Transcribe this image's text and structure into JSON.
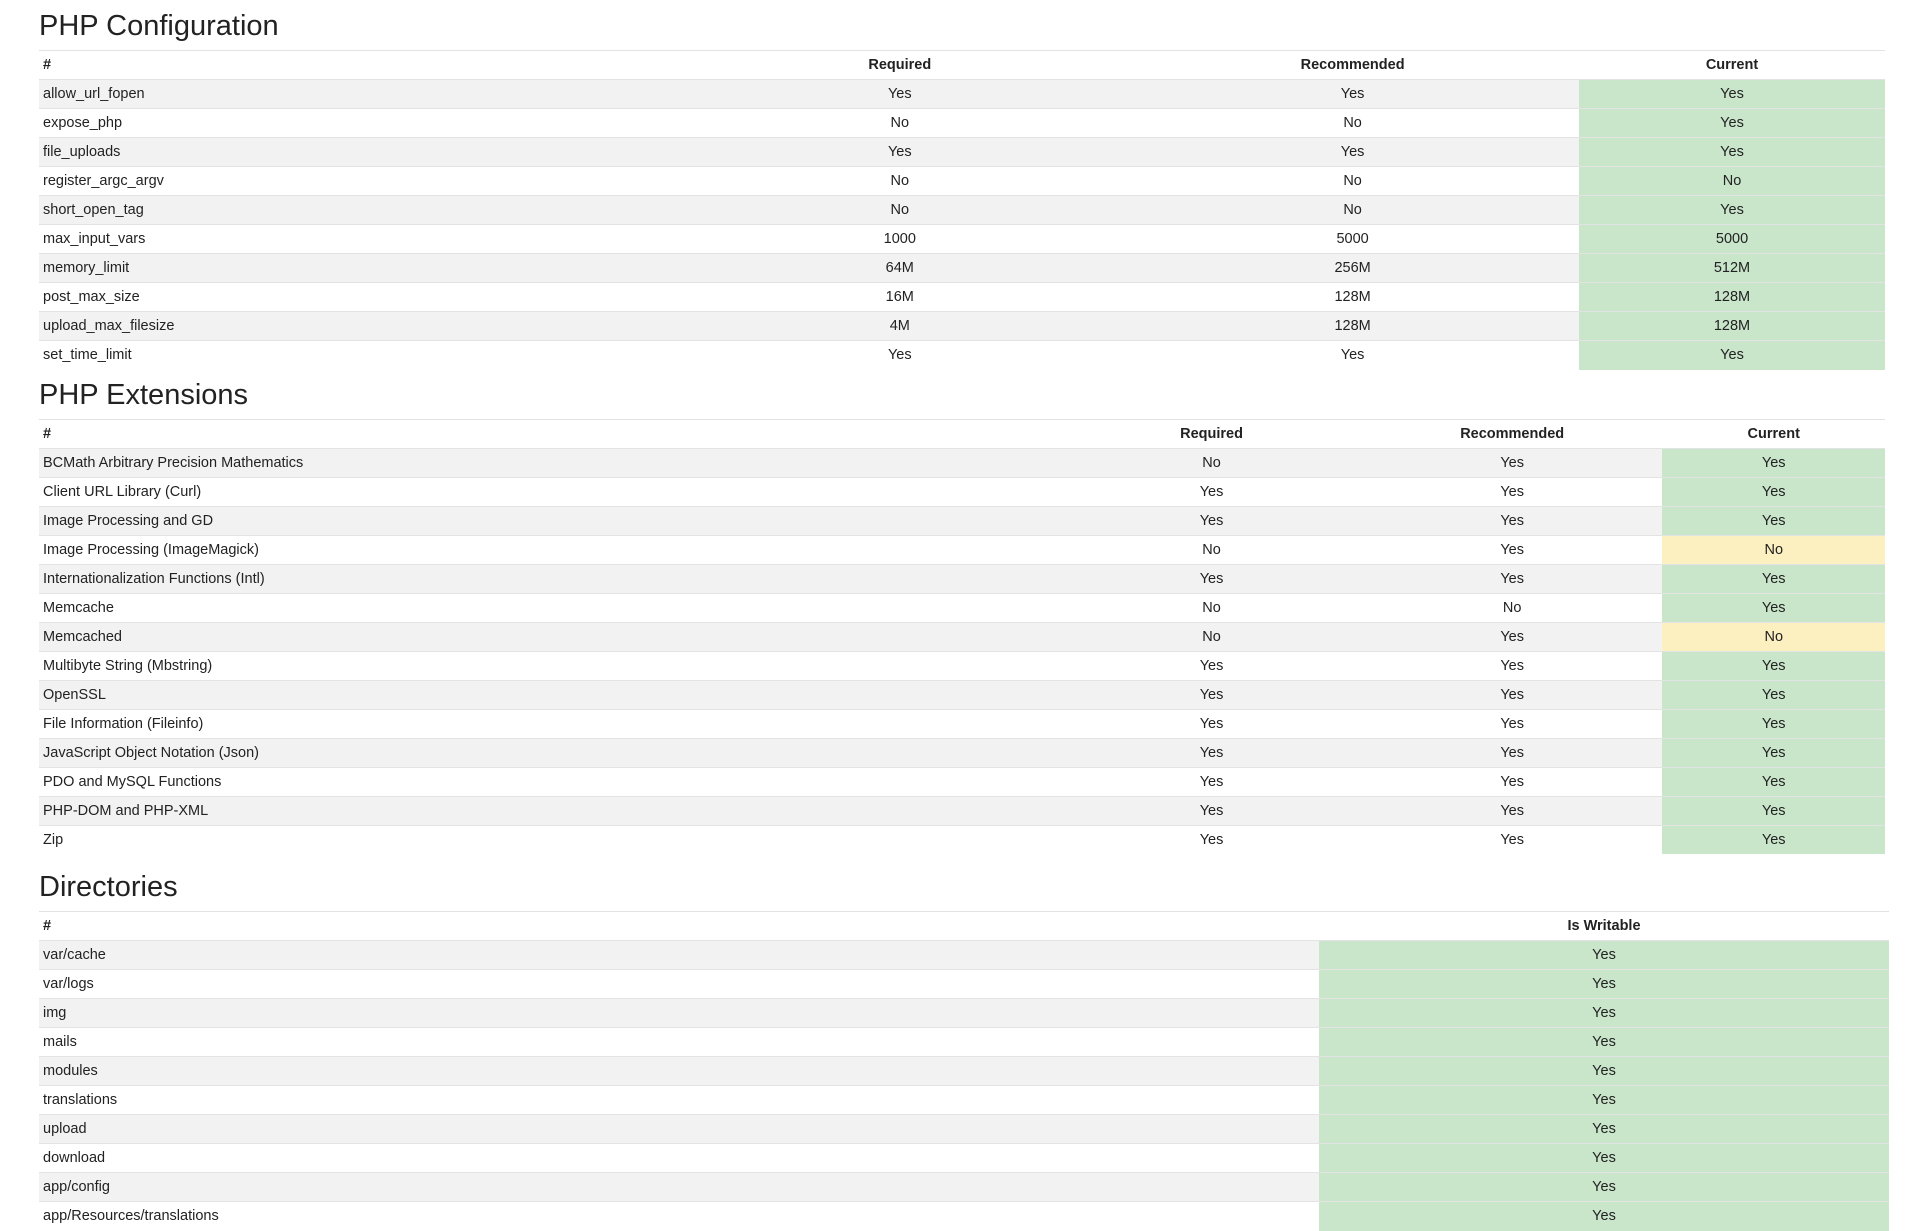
{
  "colors": {
    "ok": "#c9e6cb",
    "warn": "#fcefc0",
    "stripe": "#f2f2f2"
  },
  "config": {
    "title": "PHP Configuration",
    "headers": [
      "#",
      "Required",
      "Recommended",
      "Current"
    ],
    "rows": [
      {
        "name": "allow_url_fopen",
        "required": "Yes",
        "recommended": "Yes",
        "current": "Yes",
        "status": "ok"
      },
      {
        "name": "expose_php",
        "required": "No",
        "recommended": "No",
        "current": "Yes",
        "status": "ok"
      },
      {
        "name": "file_uploads",
        "required": "Yes",
        "recommended": "Yes",
        "current": "Yes",
        "status": "ok"
      },
      {
        "name": "register_argc_argv",
        "required": "No",
        "recommended": "No",
        "current": "No",
        "status": "ok"
      },
      {
        "name": "short_open_tag",
        "required": "No",
        "recommended": "No",
        "current": "Yes",
        "status": "ok"
      },
      {
        "name": "max_input_vars",
        "required": "1000",
        "recommended": "5000",
        "current": "5000",
        "status": "ok"
      },
      {
        "name": "memory_limit",
        "required": "64M",
        "recommended": "256M",
        "current": "512M",
        "status": "ok"
      },
      {
        "name": "post_max_size",
        "required": "16M",
        "recommended": "128M",
        "current": "128M",
        "status": "ok"
      },
      {
        "name": "upload_max_filesize",
        "required": "4M",
        "recommended": "128M",
        "current": "128M",
        "status": "ok"
      },
      {
        "name": "set_time_limit",
        "required": "Yes",
        "recommended": "Yes",
        "current": "Yes",
        "status": "ok"
      }
    ]
  },
  "extensions": {
    "title": "PHP Extensions",
    "headers": [
      "#",
      "Required",
      "Recommended",
      "Current"
    ],
    "rows": [
      {
        "name": "BCMath Arbitrary Precision Mathematics",
        "required": "No",
        "recommended": "Yes",
        "current": "Yes",
        "status": "ok"
      },
      {
        "name": "Client URL Library (Curl)",
        "required": "Yes",
        "recommended": "Yes",
        "current": "Yes",
        "status": "ok"
      },
      {
        "name": "Image Processing and GD",
        "required": "Yes",
        "recommended": "Yes",
        "current": "Yes",
        "status": "ok"
      },
      {
        "name": "Image Processing (ImageMagick)",
        "required": "No",
        "recommended": "Yes",
        "current": "No",
        "status": "warn"
      },
      {
        "name": "Internationalization Functions (Intl)",
        "required": "Yes",
        "recommended": "Yes",
        "current": "Yes",
        "status": "ok"
      },
      {
        "name": "Memcache",
        "required": "No",
        "recommended": "No",
        "current": "Yes",
        "status": "ok"
      },
      {
        "name": "Memcached",
        "required": "No",
        "recommended": "Yes",
        "current": "No",
        "status": "warn"
      },
      {
        "name": "Multibyte String (Mbstring)",
        "required": "Yes",
        "recommended": "Yes",
        "current": "Yes",
        "status": "ok"
      },
      {
        "name": "OpenSSL",
        "required": "Yes",
        "recommended": "Yes",
        "current": "Yes",
        "status": "ok"
      },
      {
        "name": "File Information (Fileinfo)",
        "required": "Yes",
        "recommended": "Yes",
        "current": "Yes",
        "status": "ok"
      },
      {
        "name": "JavaScript Object Notation (Json)",
        "required": "Yes",
        "recommended": "Yes",
        "current": "Yes",
        "status": "ok"
      },
      {
        "name": "PDO and MySQL Functions",
        "required": "Yes",
        "recommended": "Yes",
        "current": "Yes",
        "status": "ok"
      },
      {
        "name": "PHP-DOM and PHP-XML",
        "required": "Yes",
        "recommended": "Yes",
        "current": "Yes",
        "status": "ok"
      },
      {
        "name": "Zip",
        "required": "Yes",
        "recommended": "Yes",
        "current": "Yes",
        "status": "ok"
      }
    ]
  },
  "directories": {
    "title": "Directories",
    "headers": [
      "#",
      "Is Writable"
    ],
    "rows": [
      {
        "name": "var/cache",
        "writable": "Yes",
        "status": "ok"
      },
      {
        "name": "var/logs",
        "writable": "Yes",
        "status": "ok"
      },
      {
        "name": "img",
        "writable": "Yes",
        "status": "ok"
      },
      {
        "name": "mails",
        "writable": "Yes",
        "status": "ok"
      },
      {
        "name": "modules",
        "writable": "Yes",
        "status": "ok"
      },
      {
        "name": "translations",
        "writable": "Yes",
        "status": "ok"
      },
      {
        "name": "upload",
        "writable": "Yes",
        "status": "ok"
      },
      {
        "name": "download",
        "writable": "Yes",
        "status": "ok"
      },
      {
        "name": "app/config",
        "writable": "Yes",
        "status": "ok"
      },
      {
        "name": "app/Resources/translations",
        "writable": "Yes",
        "status": "ok"
      }
    ]
  }
}
